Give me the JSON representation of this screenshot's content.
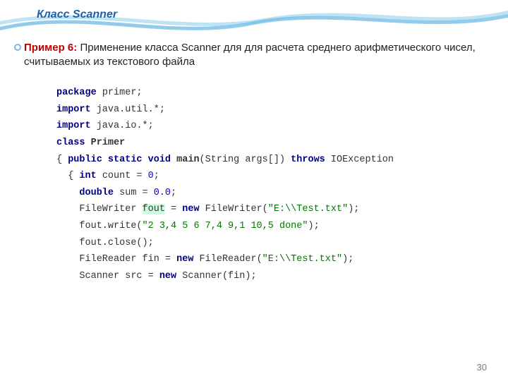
{
  "header": {
    "title": "Класс Scanner"
  },
  "body": {
    "example_label": "Пример 6:",
    "example_text": " Применение класса Scanner для для расчета среднего арифметического чисел, считываемых из текстового файла"
  },
  "code": {
    "l1a": "package",
    "l1b": " primer;",
    "l2a": "import",
    "l2b": " java.util.*;",
    "l3a": "import",
    "l3b": " java.io.*;",
    "l4a": "class",
    "l4b": " ",
    "l4c": "Primer",
    "l5a": "{ ",
    "l5b": "public static void",
    "l5c": " ",
    "l5d": "main",
    "l5e": "(String args[]) ",
    "l5f": "throws",
    "l5g": " IOException",
    "l6a": "  { ",
    "l6b": "int",
    "l6c": " count = ",
    "l6d": "0",
    "l6e": ";",
    "l7a": "    ",
    "l7b": "double",
    "l7c": " sum = ",
    "l7d": "0.0",
    "l7e": ";",
    "l8a": "    FileWriter ",
    "l8b": "fout",
    "l8c": " = ",
    "l8d": "new",
    "l8e": " FileWriter(",
    "l8f": "\"E:\\\\Test.txt\"",
    "l8g": ");",
    "l9a": "    fout.write(",
    "l9b": "\"2 3,4 5 6 7,4 9,1 10,5 done\"",
    "l9c": ");",
    "l10a": "    fout.close();",
    "l11a": "    FileReader fin = ",
    "l11b": "new",
    "l11c": " FileReader(",
    "l11d": "\"E:\\\\Test.txt\"",
    "l11e": ");",
    "l12a": "    Scanner src = ",
    "l12b": "new",
    "l12c": " Scanner(fin);"
  },
  "page": {
    "number": "30"
  }
}
